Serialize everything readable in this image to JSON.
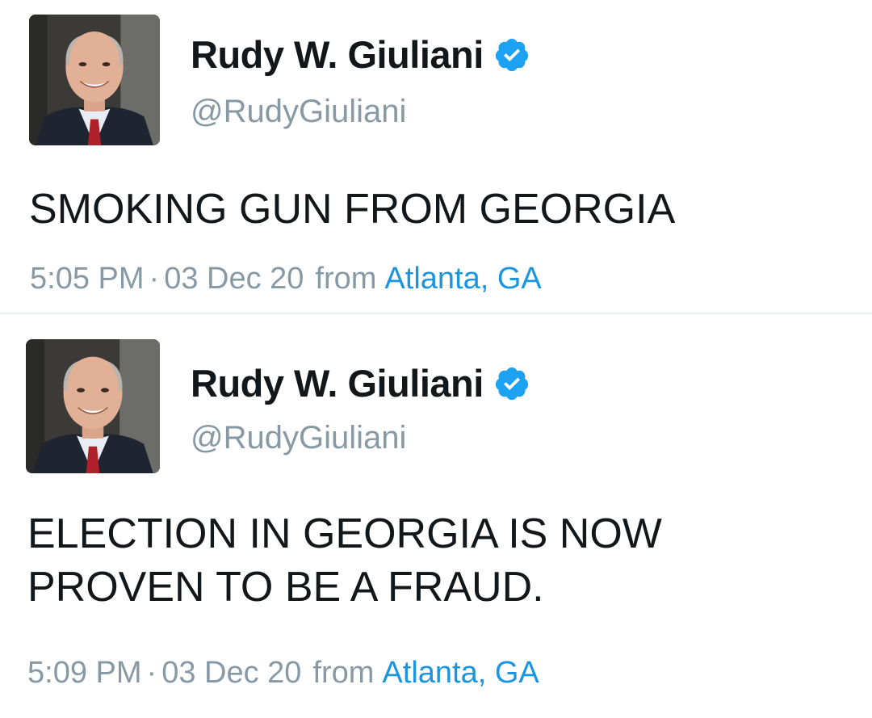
{
  "tweets": [
    {
      "display_name": "Rudy W. Giuliani",
      "handle": "@RudyGiuliani",
      "verified_icon": "verified-badge-icon",
      "text": "SMOKING GUN FROM GEORGIA",
      "time": "5:05 PM",
      "separator": "·",
      "date": "03 Dec 20",
      "from_label": "from",
      "location": "Atlanta, GA"
    },
    {
      "display_name": "Rudy W. Giuliani",
      "handle": "@RudyGiuliani",
      "verified_icon": "verified-badge-icon",
      "text": "ELECTION IN GEORGIA IS NOW\nPROVEN TO BE A FRAUD.",
      "time": "5:09 PM",
      "separator": "·",
      "date": "03 Dec 20",
      "from_label": "from",
      "location": "Atlanta, GA"
    }
  ],
  "colors": {
    "text_primary": "#14171a",
    "text_secondary": "#8899a6",
    "link": "#1b95e0",
    "verified": "#1da1f2",
    "divider": "#e6ecf0"
  }
}
